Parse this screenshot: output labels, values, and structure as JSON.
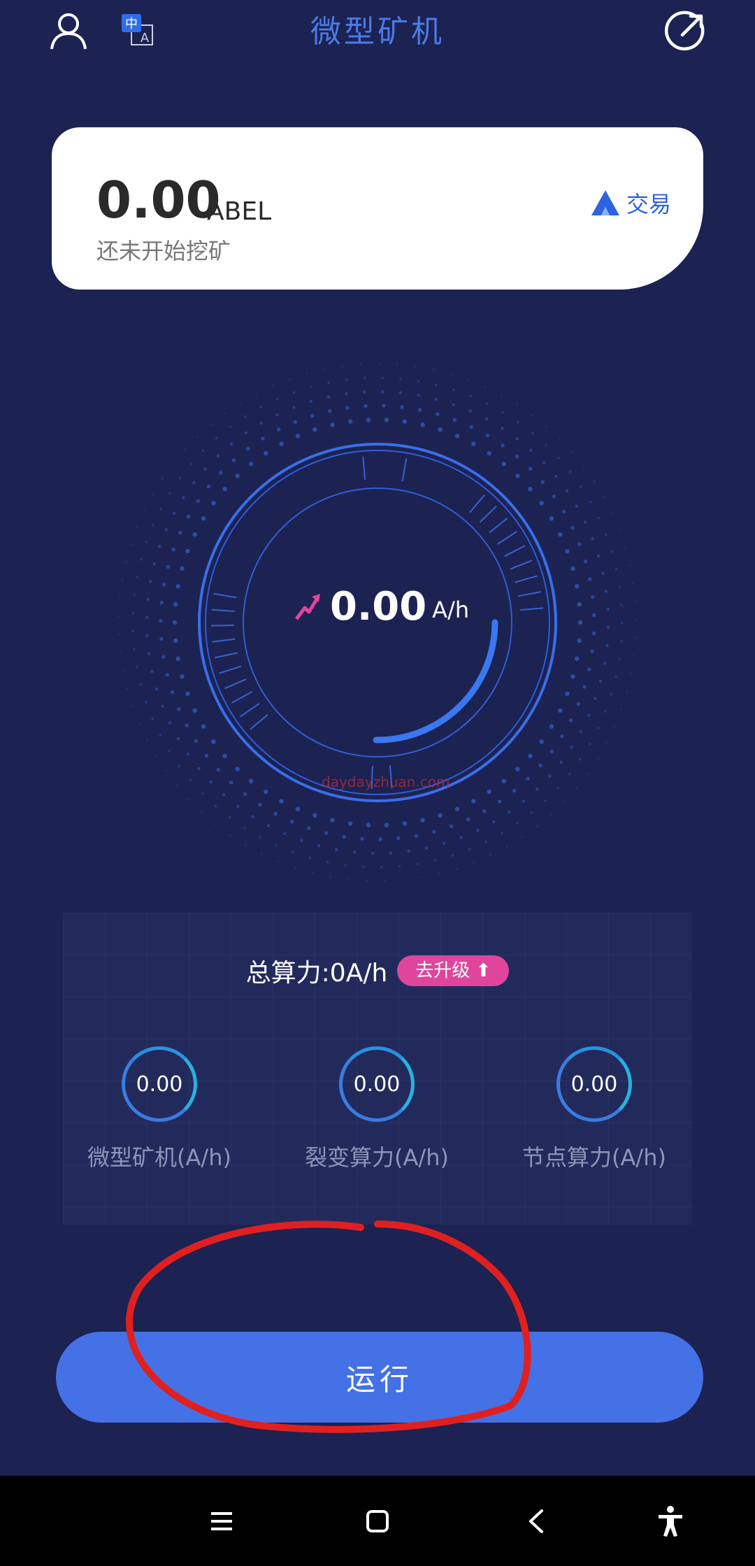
{
  "header": {
    "title": "微型矿机",
    "lang_badge_zh": "中",
    "lang_badge_en": "A"
  },
  "balance": {
    "amount": "0.00",
    "unit": "ABEL",
    "status": "还未开始挖矿",
    "trade_label": "交易"
  },
  "gauge": {
    "rate": "0.00",
    "rate_unit": "A/h",
    "watermark": "daydayzhuan.com"
  },
  "stats": {
    "total_label": "总算力:0A/h",
    "upgrade_label": "去升级",
    "items": [
      {
        "value": "0.00",
        "label": "微型矿机(A/h)"
      },
      {
        "value": "0.00",
        "label": "裂变算力(A/h)"
      },
      {
        "value": "0.00",
        "label": "节点算力(A/h)"
      }
    ]
  },
  "run_button": {
    "label": "运行"
  },
  "colors": {
    "background": "#1c2252",
    "accent_blue": "#4571e6",
    "title_blue": "#4a7ae8",
    "pink": "#e0459c",
    "annotation_red": "#e02020"
  },
  "nav": {
    "icons": [
      "menu-icon",
      "home-square-icon",
      "back-icon",
      "accessibility-icon"
    ]
  }
}
